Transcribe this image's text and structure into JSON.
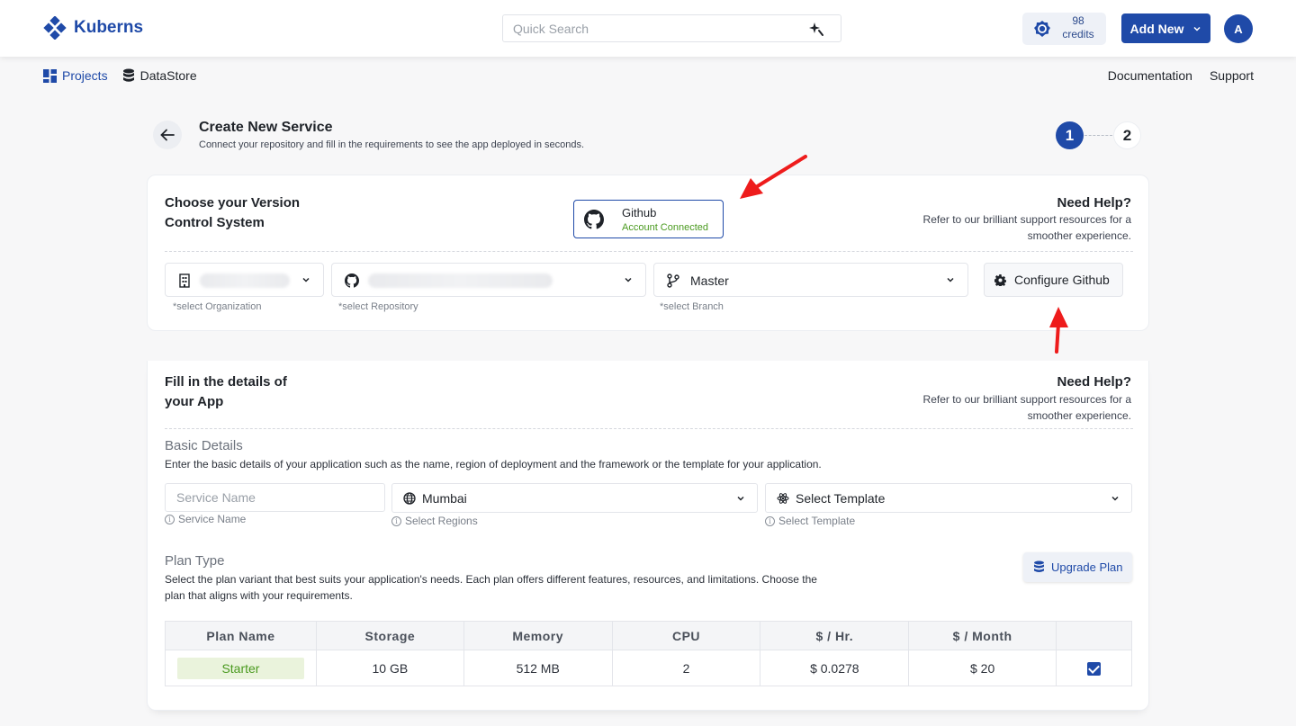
{
  "header": {
    "app_name": "Kuberns",
    "search_placeholder": "Quick Search",
    "credits_count": "98",
    "credits_label": "credits",
    "add_new_label": "Add New",
    "avatar_initial": "A"
  },
  "nav": {
    "projects": "Projects",
    "datastore": "DataStore",
    "documentation": "Documentation",
    "support": "Support"
  },
  "page": {
    "title": "Create New Service",
    "subtitle": "Connect your repository and fill in the requirements to see the app deployed in seconds.",
    "step_1": "1",
    "step_2": "2"
  },
  "vcs": {
    "heading": "Choose your Version Control System",
    "provider_name": "Github",
    "provider_status": "Account Connected",
    "help_title": "Need Help?",
    "help_text": "Refer to our brilliant support resources for a smoother experience.",
    "org_hint": "*select Organization",
    "repo_hint": "*select Repository",
    "branch_value": "Master",
    "branch_hint": "*select Branch",
    "configure_label": "Configure Github"
  },
  "app_details": {
    "heading": "Fill in the details of your App",
    "help_title": "Need Help?",
    "help_text": "Refer to our brilliant support resources for a smoother experience.",
    "basic_title": "Basic Details",
    "basic_desc": "Enter the basic details of your application such as the name, region of deployment and the framework or the template for your application.",
    "service_name_placeholder": "Service Name",
    "service_name_hint": "Service Name",
    "region_value": "Mumbai",
    "region_hint": "Select Regions",
    "template_value": "Select Template",
    "template_hint": "Select Template"
  },
  "plan": {
    "title": "Plan Type",
    "desc": "Select the plan variant that best suits your application's needs. Each plan offers different features, resources, and limitations. Choose the plan that aligns with your requirements.",
    "upgrade_label": "Upgrade Plan",
    "columns": [
      "Plan Name",
      "Storage",
      "Memory",
      "CPU",
      "$ / Hr.",
      "$ / Month",
      ""
    ],
    "rows": [
      {
        "name": "Starter",
        "storage": "10 GB",
        "memory": "512 MB",
        "cpu": "2",
        "hourly": "$ 0.0278",
        "monthly": "$ 20",
        "selected": true
      }
    ]
  },
  "colors": {
    "brand": "#1f4aa8",
    "success": "#4a9a1f",
    "annotation": "#ee1c1c"
  },
  "icons": {
    "logo": "kuberns-logo-icon",
    "search": "sparkle-search-icon",
    "credits": "badge-icon",
    "projects": "grid-icon",
    "datastore": "database-icon",
    "back": "arrow-left-icon",
    "github": "github-icon",
    "org": "building-icon",
    "branch": "git-branch-icon",
    "gear": "gear-icon",
    "globe": "globe-icon",
    "template": "react-icon",
    "upgrade": "coins-icon"
  }
}
